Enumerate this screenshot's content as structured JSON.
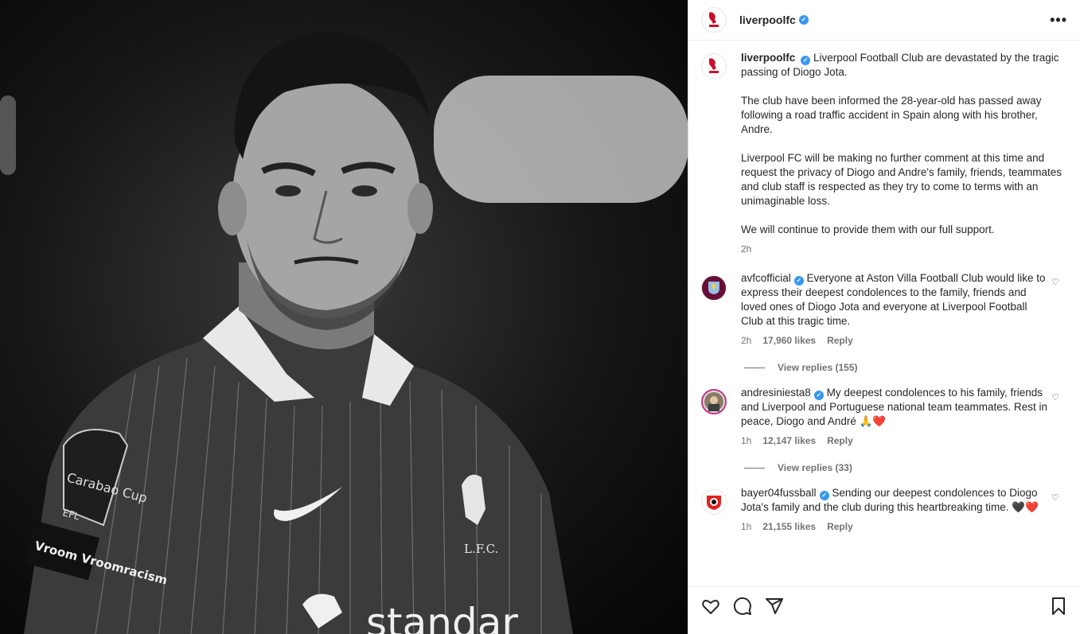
{
  "post": {
    "author": "liverpoolfc",
    "more_label": "•••",
    "caption": [
      "Liverpool Football Club are devastated by the tragic passing of Diogo Jota.",
      "The club have been informed the 28-year-old has passed away following a road traffic accident in Spain along with his brother, Andre.",
      "Liverpool FC will be making no further comment at this time and request the privacy of Diogo and Andre's family, friends, teammates and club staff is respected as they try to come to terms with an unimaginable loss.",
      "We will continue to provide them with our full support."
    ],
    "time": "2h"
  },
  "comments": [
    {
      "username": "avfcofficial",
      "text": "Everyone at Aston Villa Football Club would like to express their deepest condolences to the family, friends and loved ones of Diogo Jota and everyone at Liverpool Football Club at this tragic time.",
      "time": "2h",
      "likes": "17,960 likes",
      "reply": "Reply",
      "view_replies": "View replies (155)"
    },
    {
      "username": "andresiniesta8",
      "text": "My deepest condolences to his family, friends and Liverpool and Portuguese national team teammates. Rest in peace, Diogo and André 🙏❤️",
      "time": "1h",
      "likes": "12,147 likes",
      "reply": "Reply",
      "view_replies": "View replies (33)"
    },
    {
      "username": "bayer04fussball",
      "text": "Sending our deepest condolences to Diogo Jota's family and the club during this heartbreaking time. 🖤❤️",
      "time": "1h",
      "likes": "21,155 likes",
      "reply": "Reply"
    }
  ],
  "icons": {
    "like": "heart-icon",
    "comment": "comment-icon",
    "share": "share-icon",
    "save": "bookmark-icon"
  },
  "photo": {
    "badge_cup": "Carabao Cup",
    "badge_efl": "EFL",
    "sleeve_sponsor": "Vroom Vroomracism",
    "crest_text": "L.F.C.",
    "sponsor": "standar"
  },
  "colors": {
    "verified": "#3897f0",
    "liverpool_red": "#c8102e",
    "villa_claret": "#670e36"
  }
}
